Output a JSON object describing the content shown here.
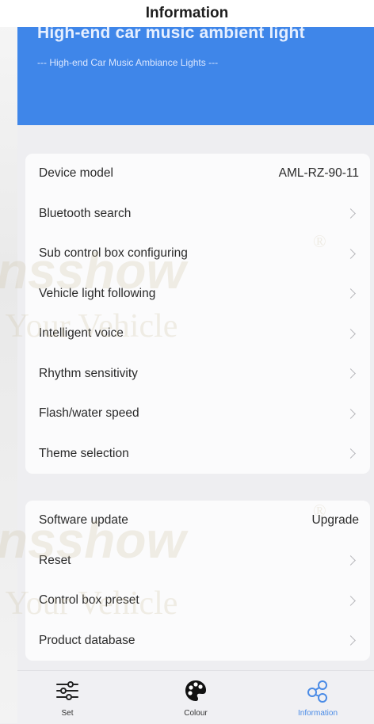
{
  "nav": {
    "title": "Information"
  },
  "hero": {
    "headline": "High-end car music ambient light",
    "subtitle": "--- High-end Car Music Ambiance Lights ---"
  },
  "settings_group_1": [
    {
      "label": "Device model",
      "value": "AML-RZ-90-11",
      "has_chevron": false
    },
    {
      "label": "Bluetooth search",
      "has_chevron": true
    },
    {
      "label": "Sub control box configuring",
      "has_chevron": true
    },
    {
      "label": "Vehicle light following",
      "has_chevron": true
    },
    {
      "label": "Intelligent voice",
      "has_chevron": true
    },
    {
      "label": "Rhythm sensitivity",
      "has_chevron": true
    },
    {
      "label": "Flash/water speed",
      "has_chevron": true
    },
    {
      "label": "Theme selection",
      "has_chevron": true
    }
  ],
  "settings_group_2": [
    {
      "label": "Software update",
      "value": "Upgrade",
      "has_chevron": false
    },
    {
      "label": "Reset",
      "has_chevron": true
    },
    {
      "label": "Control box preset",
      "has_chevron": true
    },
    {
      "label": "Product database",
      "has_chevron": true
    }
  ],
  "tabbar": {
    "tabs": [
      {
        "label": "Set",
        "icon": "sliders-icon",
        "active": false
      },
      {
        "label": "Colour",
        "icon": "palette-icon",
        "active": false
      },
      {
        "label": "Information",
        "icon": "share-nodes-icon",
        "active": true
      }
    ],
    "active_color": "#4a8be6"
  },
  "watermark": {
    "brand": "nsshow",
    "tagline": "t Your Vehicle",
    "registered": "®"
  },
  "colors": {
    "hero_blue": "#3f86e9"
  }
}
